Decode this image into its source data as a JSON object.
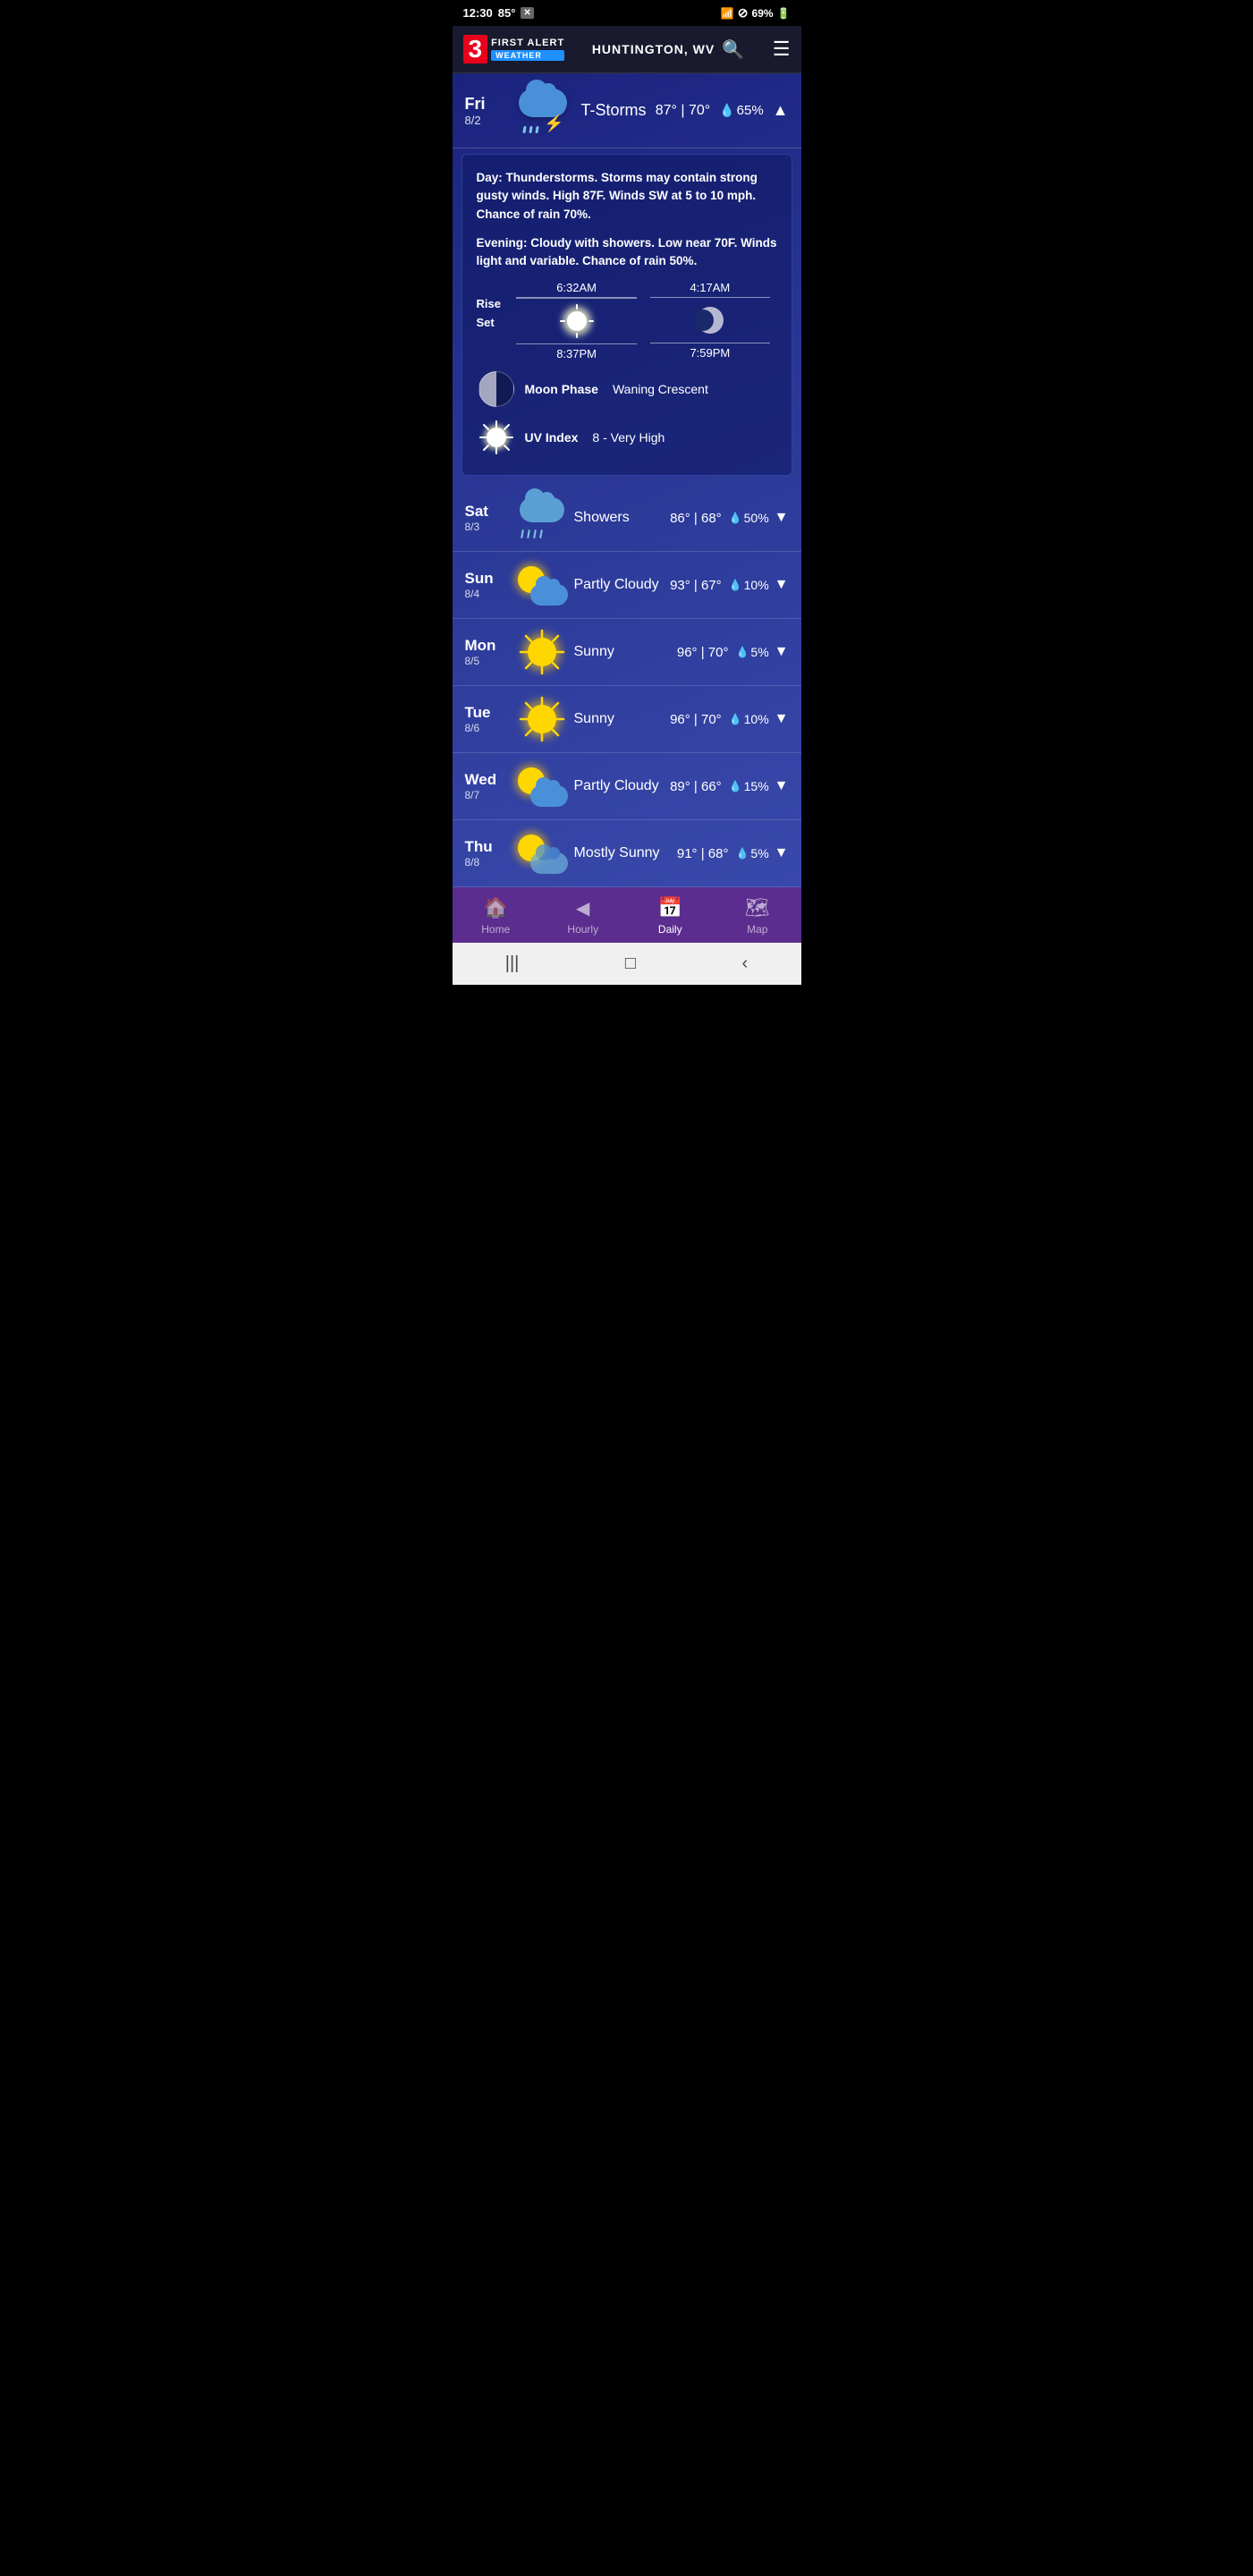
{
  "statusBar": {
    "time": "12:30",
    "temp": "85°",
    "batteryPercent": "69%"
  },
  "header": {
    "location": "HUNTINGTON, WV",
    "logo": {
      "channel": "3",
      "firstAlert": "FIRST ALERT",
      "weatherBadge": "WEATHER"
    }
  },
  "currentDay": {
    "dayName": "Fri",
    "date": "8/2",
    "condition": "T-Storms",
    "highTemp": "87°",
    "lowTemp": "70°",
    "precip": "65%",
    "isExpanded": true,
    "detail": {
      "dayText": "Day:",
      "dayDescription": "Thunderstorms. Storms may contain strong gusty winds. High 87F. Winds SW at 5 to 10 mph. Chance of rain 70%.",
      "eveningText": "Evening:",
      "eveningDescription": "Cloudy with showers. Low near 70F. Winds light and variable. Chance of rain 50%.",
      "sun": {
        "riseLabel": "Rise",
        "setLabel": "Set",
        "riseTime": "6:32AM",
        "setTime": "8:37PM"
      },
      "moon": {
        "riseTime": "4:17AM",
        "setTime": "7:59PM"
      },
      "moonPhase": {
        "label": "Moon Phase",
        "value": "Waning Crescent"
      },
      "uvIndex": {
        "label": "UV Index",
        "value": "8 - Very High"
      }
    }
  },
  "forecast": [
    {
      "dayName": "Sat",
      "date": "8/3",
      "condition": "Showers",
      "highTemp": "86°",
      "lowTemp": "68°",
      "precip": "50%",
      "iconType": "rain"
    },
    {
      "dayName": "Sun",
      "date": "8/4",
      "condition": "Partly Cloudy",
      "highTemp": "93°",
      "lowTemp": "67°",
      "precip": "10%",
      "iconType": "partly-cloudy"
    },
    {
      "dayName": "Mon",
      "date": "8/5",
      "condition": "Sunny",
      "highTemp": "96°",
      "lowTemp": "70°",
      "precip": "5%",
      "iconType": "sunny"
    },
    {
      "dayName": "Tue",
      "date": "8/6",
      "condition": "Sunny",
      "highTemp": "96°",
      "lowTemp": "70°",
      "precip": "10%",
      "iconType": "sunny"
    },
    {
      "dayName": "Wed",
      "date": "8/7",
      "condition": "Partly Cloudy",
      "highTemp": "89°",
      "lowTemp": "66°",
      "precip": "15%",
      "iconType": "partly-cloudy"
    },
    {
      "dayName": "Thu",
      "date": "8/8",
      "condition": "Mostly Sunny",
      "highTemp": "91°",
      "lowTemp": "68°",
      "precip": "5%",
      "iconType": "mostly-sunny"
    }
  ],
  "bottomNav": {
    "items": [
      {
        "id": "home",
        "label": "Home",
        "icon": "🏠",
        "active": false
      },
      {
        "id": "hourly",
        "label": "Hourly",
        "icon": "◀",
        "active": false
      },
      {
        "id": "daily",
        "label": "Daily",
        "icon": "📅",
        "active": true
      },
      {
        "id": "map",
        "label": "Map",
        "icon": "🗺",
        "active": false
      }
    ]
  },
  "systemNav": {
    "back": "‹",
    "home": "□",
    "recent": "|||"
  }
}
